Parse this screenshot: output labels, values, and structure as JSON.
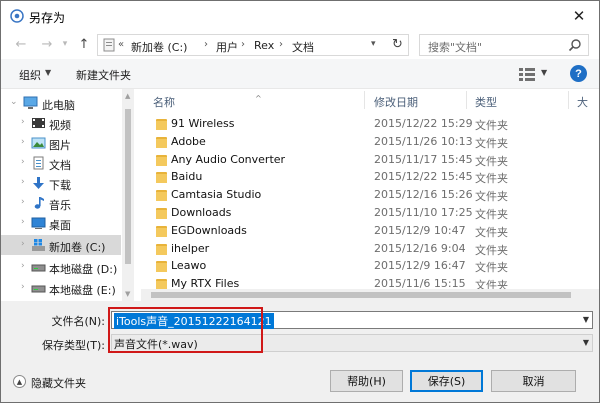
{
  "window": {
    "title": "另存为"
  },
  "nav": {
    "breadcrumb": [
      "新加卷 (C:)",
      "用户",
      "Rex",
      "文档"
    ],
    "overflow": "«",
    "search_placeholder": "搜索\"文档\""
  },
  "toolbar": {
    "organize": "组织",
    "new_folder": "新建文件夹",
    "help": "?"
  },
  "sidebar": {
    "items": [
      {
        "label": "此电脑",
        "icon": "computer-icon"
      },
      {
        "label": "视频",
        "icon": "video-icon"
      },
      {
        "label": "图片",
        "icon": "picture-icon"
      },
      {
        "label": "文档",
        "icon": "document-icon"
      },
      {
        "label": "下载",
        "icon": "download-icon"
      },
      {
        "label": "音乐",
        "icon": "music-icon"
      },
      {
        "label": "桌面",
        "icon": "desktop-icon"
      },
      {
        "label": "新加卷 (C:)",
        "icon": "windows-drive-icon",
        "selected": true
      },
      {
        "label": "本地磁盘 (D:)",
        "icon": "drive-icon"
      },
      {
        "label": "本地磁盘 (E:)",
        "icon": "drive-icon"
      }
    ]
  },
  "filelist": {
    "columns": {
      "name": "名称",
      "modified": "修改日期",
      "type": "类型",
      "size": "大"
    },
    "rows": [
      {
        "name": "91 Wireless",
        "date": "2015/12/22 15:29",
        "type": "文件夹"
      },
      {
        "name": "Adobe",
        "date": "2015/11/26 10:13",
        "type": "文件夹"
      },
      {
        "name": "Any Audio Converter",
        "date": "2015/11/17 15:45",
        "type": "文件夹"
      },
      {
        "name": "Baidu",
        "date": "2015/12/22 15:45",
        "type": "文件夹"
      },
      {
        "name": "Camtasia Studio",
        "date": "2015/12/16 15:26",
        "type": "文件夹"
      },
      {
        "name": "Downloads",
        "date": "2015/11/10 17:25",
        "type": "文件夹"
      },
      {
        "name": "EGDownloads",
        "date": "2015/12/9 10:47",
        "type": "文件夹"
      },
      {
        "name": "ihelper",
        "date": "2015/12/16 9:04",
        "type": "文件夹"
      },
      {
        "name": "Leawo",
        "date": "2015/12/9 16:47",
        "type": "文件夹"
      },
      {
        "name": "My RTX Files",
        "date": "2015/11/6 15:15",
        "type": "文件夹"
      }
    ]
  },
  "form": {
    "filename_label": "文件名(N):",
    "filename_value": "iTools声音_20151222164121",
    "filetype_label": "保存类型(T):",
    "filetype_value": "声音文件(*.wav)"
  },
  "footer": {
    "hide_folders": "隐藏文件夹",
    "help_button": "帮助(H)",
    "save_button": "保存(S)",
    "cancel_button": "取消"
  },
  "colors": {
    "accent": "#0078d7",
    "highlight_box": "#d01818",
    "folder": "#e8b33a"
  }
}
